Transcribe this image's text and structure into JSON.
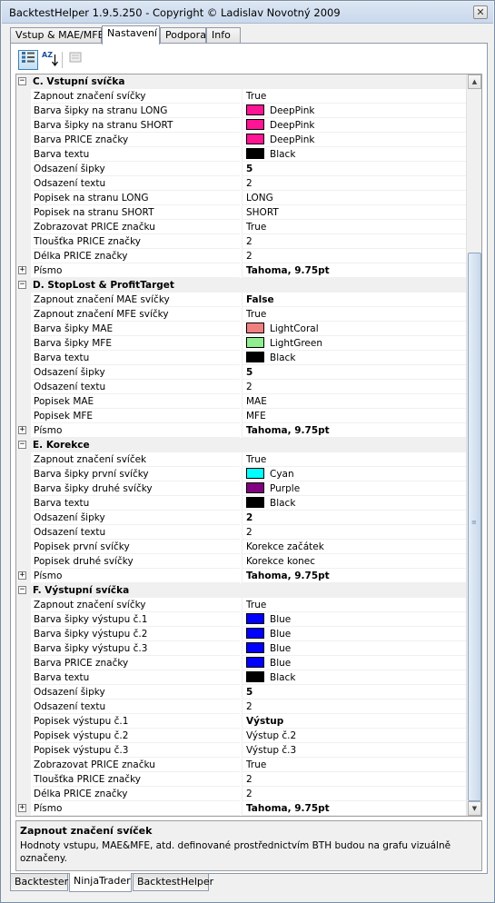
{
  "window": {
    "title": "BacktestHelper 1.9.5.250 - Copyright © Ladislav Novotný 2009",
    "close_label": "✕"
  },
  "tabs": [
    {
      "label": "Vstup & MAE/MFE",
      "active": false
    },
    {
      "label": "Nastavení",
      "active": true
    },
    {
      "label": "Podpora",
      "active": false
    },
    {
      "label": "Info",
      "active": false
    }
  ],
  "toolbar": {
    "icons": [
      "categorized-icon",
      "alphabetical-icon",
      "property-pages-icon"
    ],
    "az_label": "AZ"
  },
  "grid": {
    "sections": [
      {
        "title": "C. Vstupní svíčka",
        "expander": "−",
        "rows": [
          {
            "name": "Zapnout značení svíčky",
            "value": "True"
          },
          {
            "name": "Barva šipky na stranu LONG",
            "value": "DeepPink",
            "color": "#ff1493"
          },
          {
            "name": "Barva šipky na stranu SHORT",
            "value": "DeepPink",
            "color": "#ff1493"
          },
          {
            "name": "Barva PRICE značky",
            "value": "DeepPink",
            "color": "#ff1493"
          },
          {
            "name": "Barva textu",
            "value": "Black",
            "color": "#000000"
          },
          {
            "name": "Odsazení šipky",
            "value": "5",
            "bold": true
          },
          {
            "name": "Odsazení textu",
            "value": "2"
          },
          {
            "name": "Popisek na stranu LONG",
            "value": "LONG"
          },
          {
            "name": "Popisek na stranu SHORT",
            "value": "SHORT"
          },
          {
            "name": "Zobrazovat PRICE značku",
            "value": "True"
          },
          {
            "name": "Tloušťka PRICE značky",
            "value": "2"
          },
          {
            "name": "Délka PRICE značky",
            "value": "2"
          },
          {
            "name": "Písmo",
            "value": "Tahoma, 9.75pt",
            "bold": true,
            "expander": "+"
          }
        ]
      },
      {
        "title": "D. StopLost & ProfitTarget",
        "expander": "−",
        "rows": [
          {
            "name": "Zapnout značení MAE svíčky",
            "value": "False",
            "bold": true
          },
          {
            "name": "Zapnout značení MFE svíčky",
            "value": "True"
          },
          {
            "name": "Barva šipky MAE",
            "value": "LightCoral",
            "color": "#f08080"
          },
          {
            "name": "Barva šipky MFE",
            "value": "LightGreen",
            "color": "#90ee90"
          },
          {
            "name": "Barva textu",
            "value": "Black",
            "color": "#000000"
          },
          {
            "name": "Odsazení šipky",
            "value": "5",
            "bold": true
          },
          {
            "name": "Odsazení textu",
            "value": "2"
          },
          {
            "name": "Popisek MAE",
            "value": "MAE"
          },
          {
            "name": "Popisek MFE",
            "value": "MFE"
          },
          {
            "name": "Písmo",
            "value": "Tahoma, 9.75pt",
            "bold": true,
            "expander": "+"
          }
        ]
      },
      {
        "title": "E. Korekce",
        "expander": "−",
        "rows": [
          {
            "name": "Zapnout značení svíček",
            "value": "True"
          },
          {
            "name": "Barva šipky první svíčky",
            "value": "Cyan",
            "color": "#00ffff"
          },
          {
            "name": "Barva šipky druhé svíčky",
            "value": "Purple",
            "color": "#800080"
          },
          {
            "name": "Barva textu",
            "value": "Black",
            "color": "#000000"
          },
          {
            "name": "Odsazení šipky",
            "value": "2",
            "bold": true
          },
          {
            "name": "Odsazení textu",
            "value": "2"
          },
          {
            "name": "Popisek první svíčky",
            "value": "Korekce začátek"
          },
          {
            "name": "Popisek druhé svíčky",
            "value": "Korekce konec"
          },
          {
            "name": "Písmo",
            "value": "Tahoma, 9.75pt",
            "bold": true,
            "expander": "+"
          }
        ]
      },
      {
        "title": "F. Výstupní svíčka",
        "expander": "−",
        "rows": [
          {
            "name": "Zapnout značení svíčky",
            "value": "True"
          },
          {
            "name": "Barva šipky výstupu č.1",
            "value": "Blue",
            "color": "#0000ff"
          },
          {
            "name": "Barva šipky výstupu č.2",
            "value": "Blue",
            "color": "#0000ff"
          },
          {
            "name": "Barva šipky výstupu č.3",
            "value": "Blue",
            "color": "#0000ff"
          },
          {
            "name": "Barva PRICE značky",
            "value": "Blue",
            "color": "#0000ff"
          },
          {
            "name": "Barva textu",
            "value": "Black",
            "color": "#000000"
          },
          {
            "name": "Odsazení šipky",
            "value": "5",
            "bold": true
          },
          {
            "name": "Odsazení textu",
            "value": "2"
          },
          {
            "name": "Popisek výstupu č.1",
            "value": "Výstup",
            "bold": true
          },
          {
            "name": "Popisek výstupu č.2",
            "value": "Výstup č.2"
          },
          {
            "name": "Popisek výstupu č.3",
            "value": "Výstup č.3"
          },
          {
            "name": "Zobrazovat PRICE značku",
            "value": "True"
          },
          {
            "name": "Tloušťka PRICE značky",
            "value": "2"
          },
          {
            "name": "Délka PRICE značky",
            "value": "2"
          },
          {
            "name": "Písmo",
            "value": "Tahoma, 9.75pt",
            "bold": true,
            "expander": "+"
          }
        ]
      }
    ],
    "scrollbar": {
      "up_glyph": "▲",
      "down_glyph": "▼",
      "grip_glyph": "≡"
    }
  },
  "help": {
    "title": "Zapnout značení svíček",
    "description": "Hodnoty vstupu, MAE&MFE, atd. definované prostřednictvím BTH budou na grafu vizuálně označeny."
  },
  "bottom_tabs": [
    {
      "label": "Backtester",
      "active": false
    },
    {
      "label": "NinjaTrader",
      "active": true
    },
    {
      "label": "BacktestHelper",
      "active": false
    }
  ]
}
